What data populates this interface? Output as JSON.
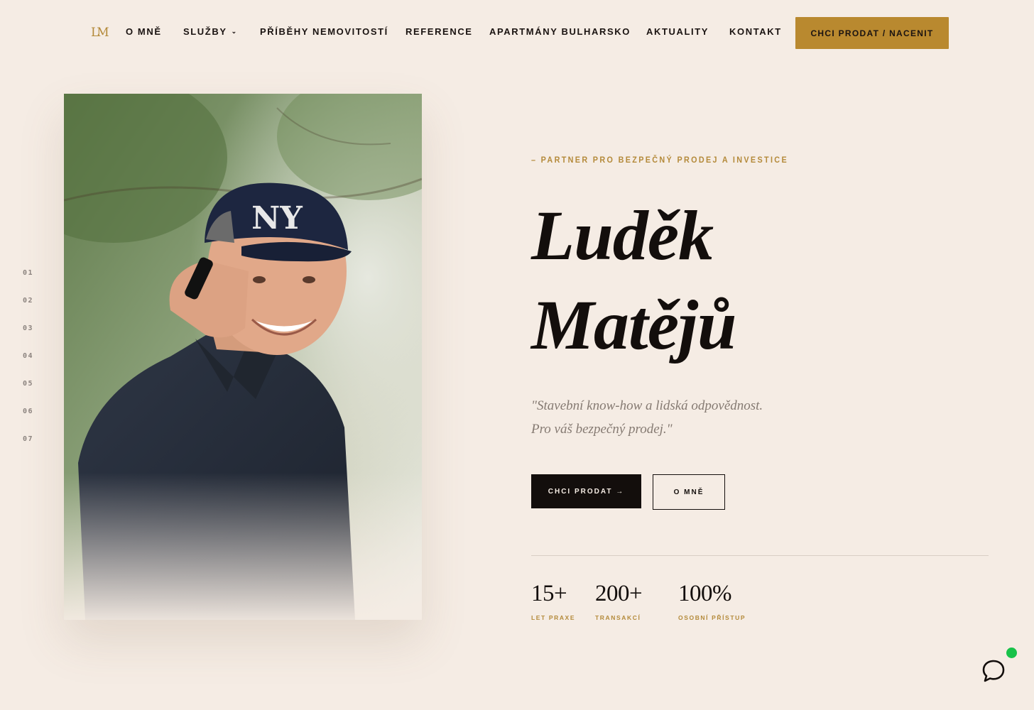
{
  "nav": {
    "logo": "LM",
    "items": [
      {
        "label": "O MNĚ"
      },
      {
        "label": "SLUŽBY"
      },
      {
        "label": "PŘÍBĚHY NEMOVITOSTÍ"
      },
      {
        "label": "REFERENCE"
      },
      {
        "label": "APARTMÁNY BULHARSKO"
      },
      {
        "label": "AKTUALITY"
      },
      {
        "label": "KONTAKT"
      }
    ],
    "cta": "CHCI PRODAT / NACENIT",
    "dropdown_icon": "chevron-down-icon"
  },
  "side_pagination": [
    "01",
    "02",
    "03",
    "04",
    "05",
    "06",
    "07"
  ],
  "hero": {
    "eyebrow": "– PARTNER PRO BEZPEČNÝ PRODEJ A INVESTICE",
    "first_name": "Luděk",
    "last_name": "Matějů",
    "quote_line1": "\"Stavební know-how a lidská odpovědnost.",
    "quote_line2": "Pro váš bezpečný prodej.\"",
    "primary_button": "CHCI PRODAT →",
    "secondary_button": "O MNĚ"
  },
  "stats": [
    {
      "value": "15+",
      "label": "LET PRAXE"
    },
    {
      "value": "200+",
      "label": "TRANSAKCÍ"
    },
    {
      "value": "100%",
      "label": "OSOBNÍ PŘÍSTUP"
    }
  ],
  "colors": {
    "background": "#f5ece4",
    "accent": "#b9892f",
    "dark": "#130e0c",
    "online": "#18c24a"
  },
  "chat": {
    "icon": "chat-bubble-icon",
    "status": "online"
  }
}
